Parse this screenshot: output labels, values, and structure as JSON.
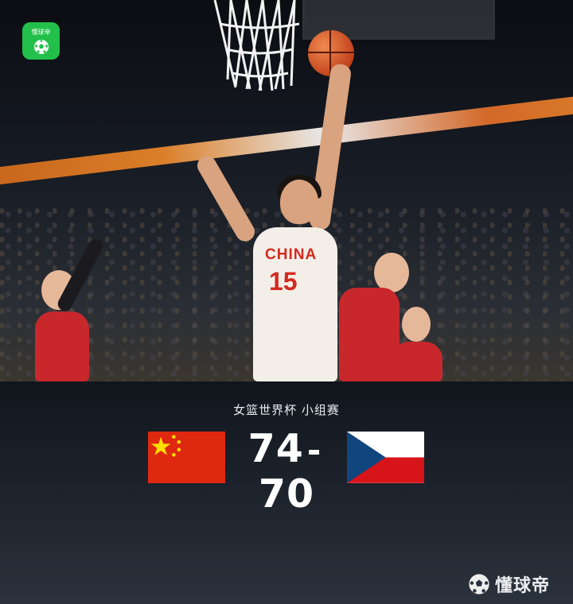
{
  "app": {
    "logo_icon": "dongqiudi-app-logo-icon",
    "logo_text": "懂球帝",
    "brand_color": "#22c04a"
  },
  "photo": {
    "jersey_text": "CHINA",
    "jersey_number": "15"
  },
  "match": {
    "event": "女篮世界杯 小组赛",
    "home_team_flag": "china-flag-icon",
    "away_team_flag": "czech-flag-icon",
    "home_score": "74",
    "away_score": "70",
    "separator": "-"
  },
  "watermark": {
    "icon": "soccer-ball-icon",
    "text": "懂球帝"
  },
  "colors": {
    "panel_bg": "#1a2029",
    "china_red": "#de2910",
    "china_yellow": "#ffde00",
    "czech_blue": "#11457e",
    "czech_red": "#d7141a"
  }
}
